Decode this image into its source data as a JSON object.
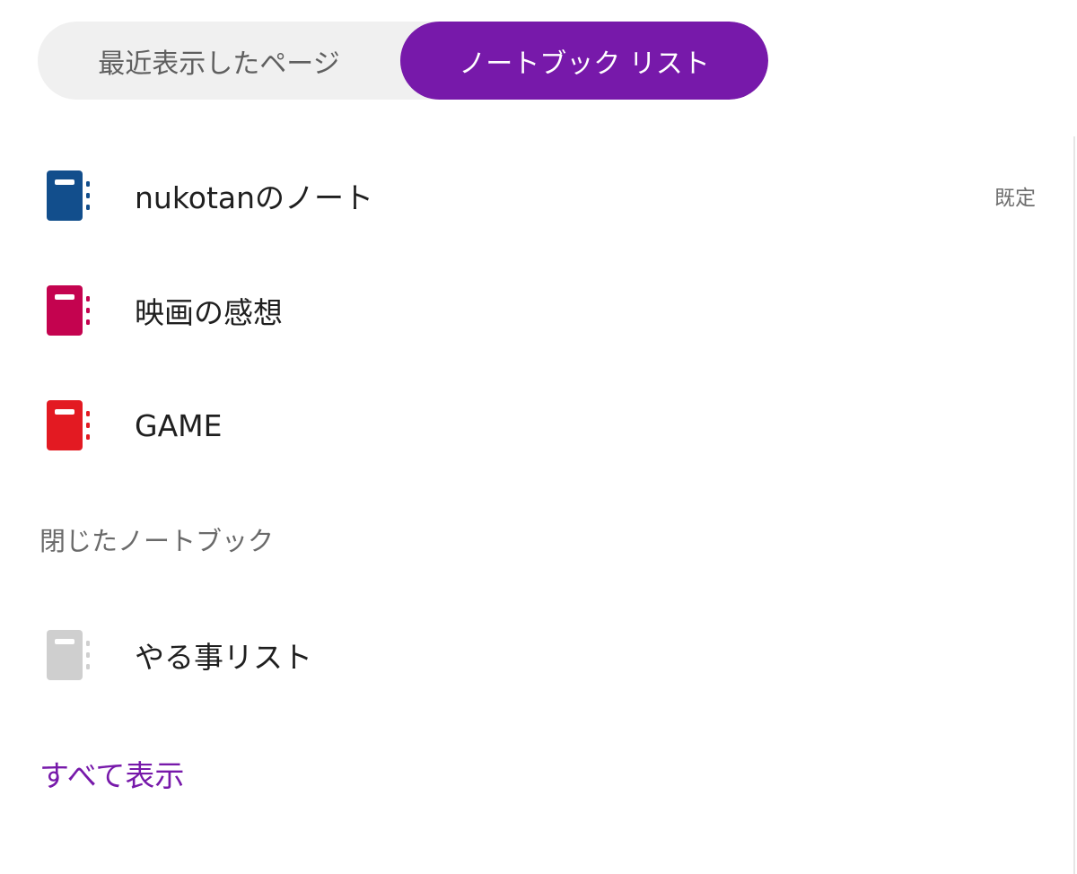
{
  "tabs": {
    "recent_label": "最近表示したページ",
    "notebooks_label": "ノートブック リスト",
    "active": "notebooks"
  },
  "notebooks": [
    {
      "name": "nukotanのノート",
      "tag": "既定",
      "icon": "notebook-icon",
      "color": "#124e8c"
    },
    {
      "name": "映画の感想",
      "tag": "",
      "icon": "notebook-icon",
      "color": "#c4034f"
    },
    {
      "name": "GAME",
      "tag": "",
      "icon": "notebook-icon",
      "color": "#e31a22"
    }
  ],
  "closed_section": {
    "header": "閉じたノートブック",
    "notebooks": [
      {
        "name": "やる事リスト",
        "icon": "notebook-icon",
        "color": "#cfcfcf"
      }
    ]
  },
  "show_all_label": "すべて表示",
  "colors": {
    "accent": "#7719aa",
    "tab_background": "#f0f0f0"
  }
}
